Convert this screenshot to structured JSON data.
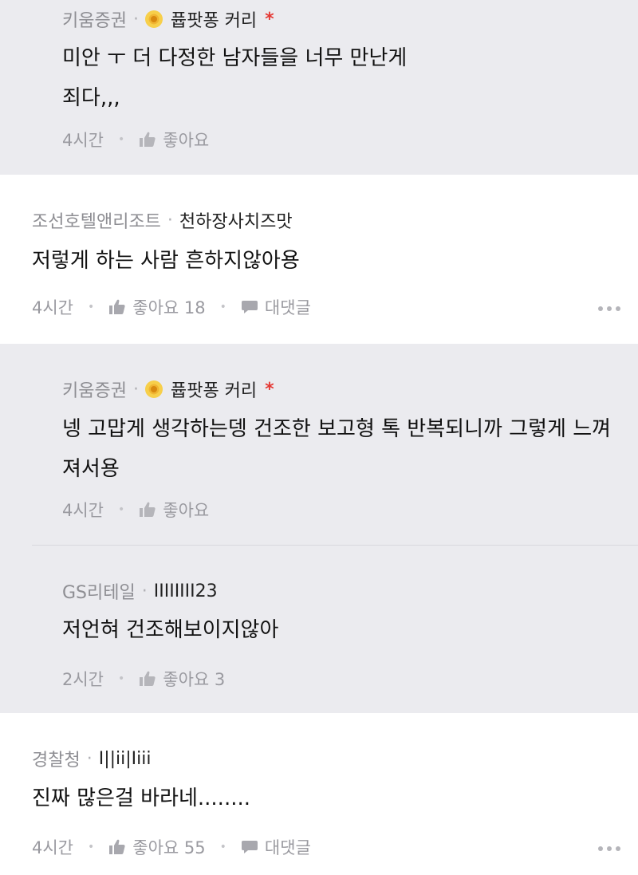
{
  "comments": [
    {
      "company": "키움증권",
      "nick": "퓹팟퐁 커리",
      "body": "미안 ㅜ 더 다정한 남자들을 너무 만난게\n죄다,,,",
      "time": "4시간",
      "like_label": "좋아요"
    },
    {
      "company": "조선호텔앤리조트",
      "nick": "천하장사치즈맛",
      "body": "저렇게 하는 사람 흔하지않아용",
      "time": "4시간",
      "like_label": "좋아요 18",
      "reply_label": "대댓글"
    },
    {
      "company": "키움증권",
      "nick": "퓹팟퐁 커리",
      "body": "넹 고맙게 생각하는뎅 건조한 보고형 톡 반복되니까 그렇게 느껴\n져서용",
      "time": "4시간",
      "like_label": "좋아요"
    },
    {
      "company": "GS리테일",
      "nick": "IIIIIIII23",
      "body": "저언혀 건조해보이지않아",
      "time": "2시간",
      "like_label": "좋아요 3"
    },
    {
      "company": "경찰청",
      "nick": "I||ii|Iiii",
      "body": "진짜 많은걸 바라네........",
      "time": "4시간",
      "like_label": "좋아요 55",
      "reply_label": "대댓글"
    }
  ],
  "meta_separator": "·",
  "author_star": "*",
  "icons": {
    "badge": "gold-flower-badge-icon",
    "like": "thumbs-up-icon",
    "reply": "speech-bubble-icon",
    "more": "more-dots-icon"
  },
  "colors": {
    "reply_bg": "#ebebef",
    "author_star": "#e53935",
    "muted": "#9a9aa0"
  }
}
